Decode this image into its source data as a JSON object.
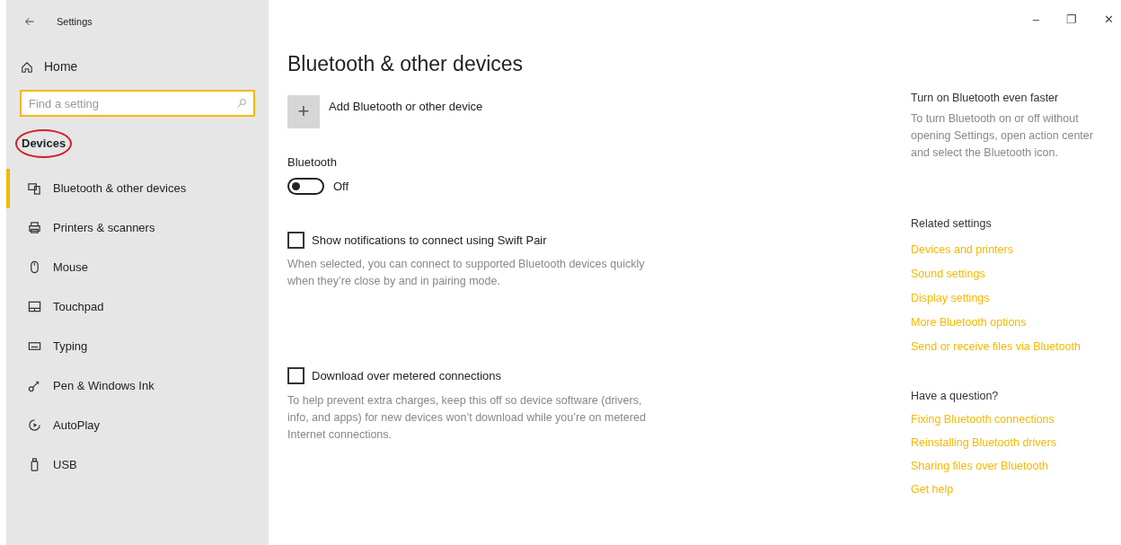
{
  "window": {
    "title": "Settings",
    "controls": [
      "–",
      "❐",
      "✕"
    ]
  },
  "sidebar": {
    "home": "Home",
    "search": {
      "placeholder": "Find a setting"
    },
    "section": {
      "label": "Devices",
      "circled": true
    },
    "items": [
      {
        "label": "Bluetooth & other devices",
        "kind": "devices",
        "selected": true
      },
      {
        "label": "Printers & scanners",
        "kind": "printer",
        "selected": false
      },
      {
        "label": "Mouse",
        "kind": "mouse",
        "selected": false
      },
      {
        "label": "Touchpad",
        "kind": "touchpad",
        "selected": false
      },
      {
        "label": "Typing",
        "kind": "keyboard",
        "selected": false
      },
      {
        "label": "Pen & Windows Ink",
        "kind": "pen",
        "selected": false
      },
      {
        "label": "AutoPlay",
        "kind": "autoplay",
        "selected": false
      },
      {
        "label": "USB",
        "kind": "usb",
        "selected": false
      }
    ]
  },
  "main": {
    "title": "Bluetooth & other devices",
    "add_button": {
      "icon": "+",
      "label": "Add Bluetooth or other device"
    },
    "bluetooth": {
      "label": "Bluetooth",
      "on": false,
      "state_text": "Off"
    },
    "options": [
      {
        "label": "Show notifications to connect using Swift Pair",
        "checked": false,
        "description": "When selected, you can connect to supported Bluetooth devices quickly when they’re close by and in pairing mode."
      },
      {
        "label": "Download over metered connections",
        "checked": false,
        "description": "To help prevent extra charges, keep this off so device software (drivers, info, and apps) for new devices won’t download while you’re on metered Internet connections."
      }
    ]
  },
  "right_panel": {
    "tip": {
      "title": "Turn on Bluetooth even faster",
      "text": "To turn Bluetooth on or off without opening Settings, open action center and select the Bluetooth icon."
    },
    "related": {
      "title": "Related settings",
      "links": [
        "Devices and printers",
        "Sound settings",
        "Display settings",
        "More Bluetooth options",
        "Send or receive files via Bluetooth"
      ]
    },
    "question": {
      "title": "Have a question?",
      "links": [
        "Fixing Bluetooth connections",
        "Reinstalling Bluetooth drivers",
        "Sharing files over Bluetooth",
        "Get help"
      ]
    }
  }
}
